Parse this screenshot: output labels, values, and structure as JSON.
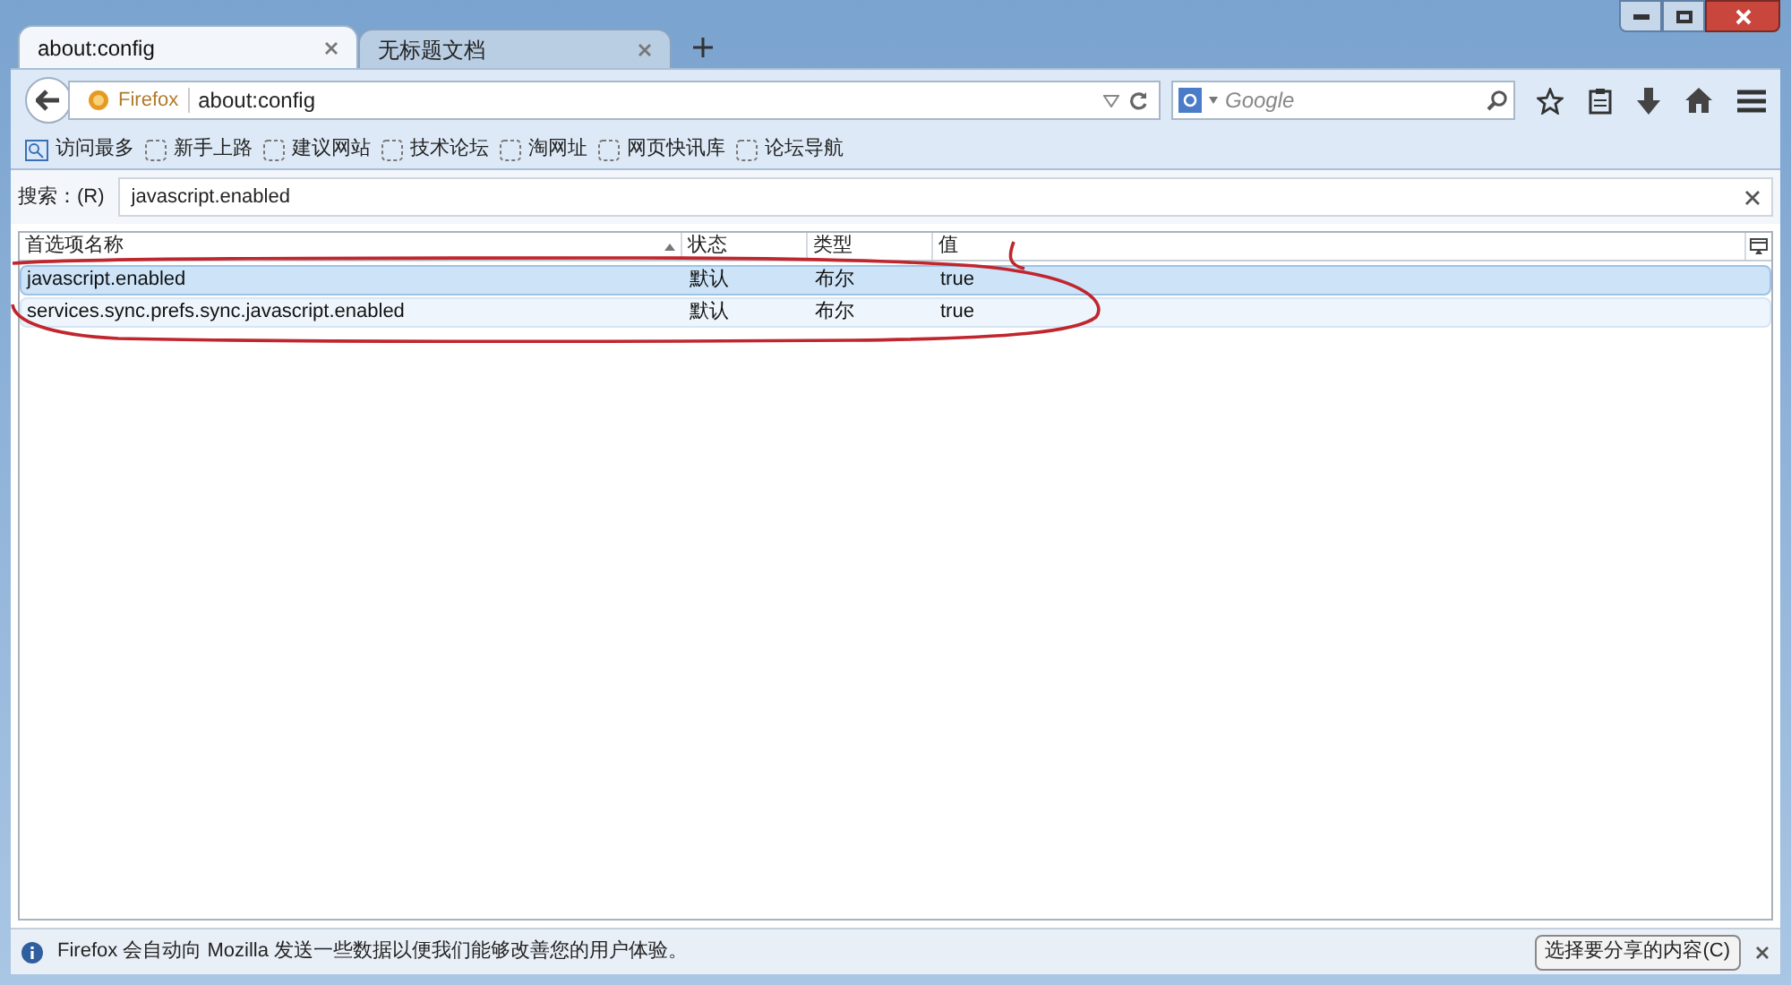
{
  "tabs": [
    {
      "label": "about:config",
      "selected": true
    },
    {
      "label": "无标题文档",
      "selected": false
    }
  ],
  "nav": {
    "identity": "Firefox",
    "url": "about:config",
    "search_placeholder": "Google"
  },
  "bookmarks": [
    {
      "label": "访问最多",
      "kind": "smart"
    },
    {
      "label": "新手上路",
      "kind": "page"
    },
    {
      "label": "建议网站",
      "kind": "page"
    },
    {
      "label": "技术论坛",
      "kind": "page"
    },
    {
      "label": "淘网址",
      "kind": "page"
    },
    {
      "label": "网页快讯库",
      "kind": "page"
    },
    {
      "label": "论坛导航",
      "kind": "page"
    }
  ],
  "filter": {
    "label": "搜索：(R)",
    "value": "javascript.enabled"
  },
  "table": {
    "columns": [
      "首选项名称",
      "状态",
      "类型",
      "值"
    ],
    "rows": [
      {
        "cells": [
          "javascript.enabled",
          "默认",
          "布尔",
          "true"
        ],
        "selected": true
      },
      {
        "cells": [
          "services.sync.prefs.sync.javascript.enabled",
          "默认",
          "布尔",
          "true"
        ],
        "selected": false
      }
    ]
  },
  "annotations": [
    {
      "kind": "ellipse"
    }
  ],
  "notification": {
    "message": "Firefox 会自动向 Mozilla 发送一些数据以便我们能够改善您的用户体验。",
    "button": "选择要分享的内容(C)"
  }
}
